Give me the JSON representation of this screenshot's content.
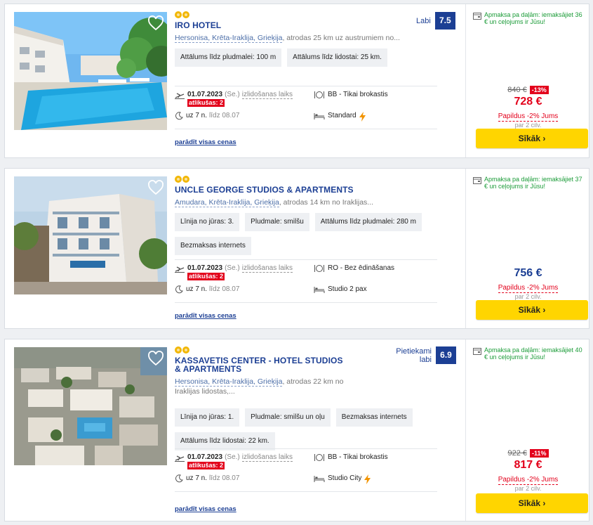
{
  "hotels": [
    {
      "name": "IRO HOTEL",
      "stars": 2,
      "location_link": "Hersonisa, Krēta-Iraklija, Grieķija",
      "location_rest": ", atrodas 25 km uz austrumiem no...",
      "tags": [
        "Attālums līdz pludmalei: 100 m",
        "Attālums līdz lidostai: 25 km."
      ],
      "date": "01.07.2023",
      "day": "(Se.)",
      "departure": "izlidošanas laiks",
      "left": "atlikušas: 2",
      "nights": "uz 7 n.",
      "until": "līdz 08.07",
      "board": "BB - Tikai brokastis",
      "room": "Standard",
      "room_bolt": true,
      "show_prices": "parādīt visas cenas",
      "rating_label": "Labi",
      "rating_score": "7.5",
      "install_text": "Apmaksa pa daļām: iemaksājiet 36 € un ceļojums ir Jūsu!",
      "old_price": "840 €",
      "discount": "-13%",
      "price": "728 €",
      "price_color": "#e3001b",
      "extra": "Papildus -2% Jums",
      "per": "par 2 cilv.",
      "button": "Sīkāk ›"
    },
    {
      "name": "UNCLE GEORGE STUDIOS & APARTMENTS",
      "stars": 2,
      "location_link": "Amudara, Krēta-Iraklija, Grieķija",
      "location_rest": ", atrodas 14 km no Iraklijas...",
      "tags": [
        "Līnija no jūras: 3.",
        "Pludmale: smilšu",
        "Attālums līdz pludmalei: 280 m",
        "Bezmaksas internets"
      ],
      "date": "01.07.2023",
      "day": "(Se.)",
      "departure": "izlidošanas laiks",
      "left": "atlikušas: 2",
      "nights": "uz 7 n.",
      "until": "līdz 08.07",
      "board": "RO - Bez ēdināšanas",
      "room": "Studio 2 pax",
      "room_bolt": false,
      "show_prices": "parādīt visas cenas",
      "rating_label": "",
      "rating_score": "",
      "install_text": "Apmaksa pa daļām: iemaksājiet 37 € un ceļojums ir Jūsu!",
      "old_price": "",
      "discount": "",
      "price": "756 €",
      "price_color": "#1c3f94",
      "extra": "Papildus -2% Jums",
      "per": "par 2 cilv.",
      "button": "Sīkāk ›"
    },
    {
      "name": "KASSAVETIS CENTER - HOTEL STUDIOS & APARTMENTS",
      "stars": 2,
      "location_link": "Hersonisa, Krēta-Iraklija, Grieķija",
      "location_rest": ", atrodas 22 km no Iraklijas lidostas,...",
      "tags": [
        "Līnija no jūras: 1.",
        "Pludmale: smilšu un oļu",
        "Bezmaksas internets",
        "Attālums līdz lidostai: 22 km."
      ],
      "date": "01.07.2023",
      "day": "(Se.)",
      "departure": "izlidošanas laiks",
      "left": "atlikušas: 2",
      "nights": "uz 7 n.",
      "until": "līdz 08.07",
      "board": "BB - Tikai brokastis",
      "room": "Studio City",
      "room_bolt": true,
      "show_prices": "parādīt visas cenas",
      "rating_label": "Pietiekami labi",
      "rating_score": "6.9",
      "install_text": "Apmaksa pa daļām: iemaksājiet 40 € un ceļojums ir Jūsu!",
      "old_price": "922 €",
      "discount": "-11%",
      "price": "817 €",
      "price_color": "#e3001b",
      "extra": "Papildus -2% Jums",
      "per": "par 2 cilv.",
      "button": "Sīkāk ›"
    }
  ],
  "colors": {
    "brand": "#1c3f94",
    "accent": "#ffd500",
    "sale": "#e3001b",
    "install": "#1a9b37"
  },
  "icons": [
    "heart-icon",
    "plane-icon",
    "moon-icon",
    "fork-knife-icon",
    "bed-icon",
    "bolt-icon",
    "calendar-card-icon"
  ]
}
